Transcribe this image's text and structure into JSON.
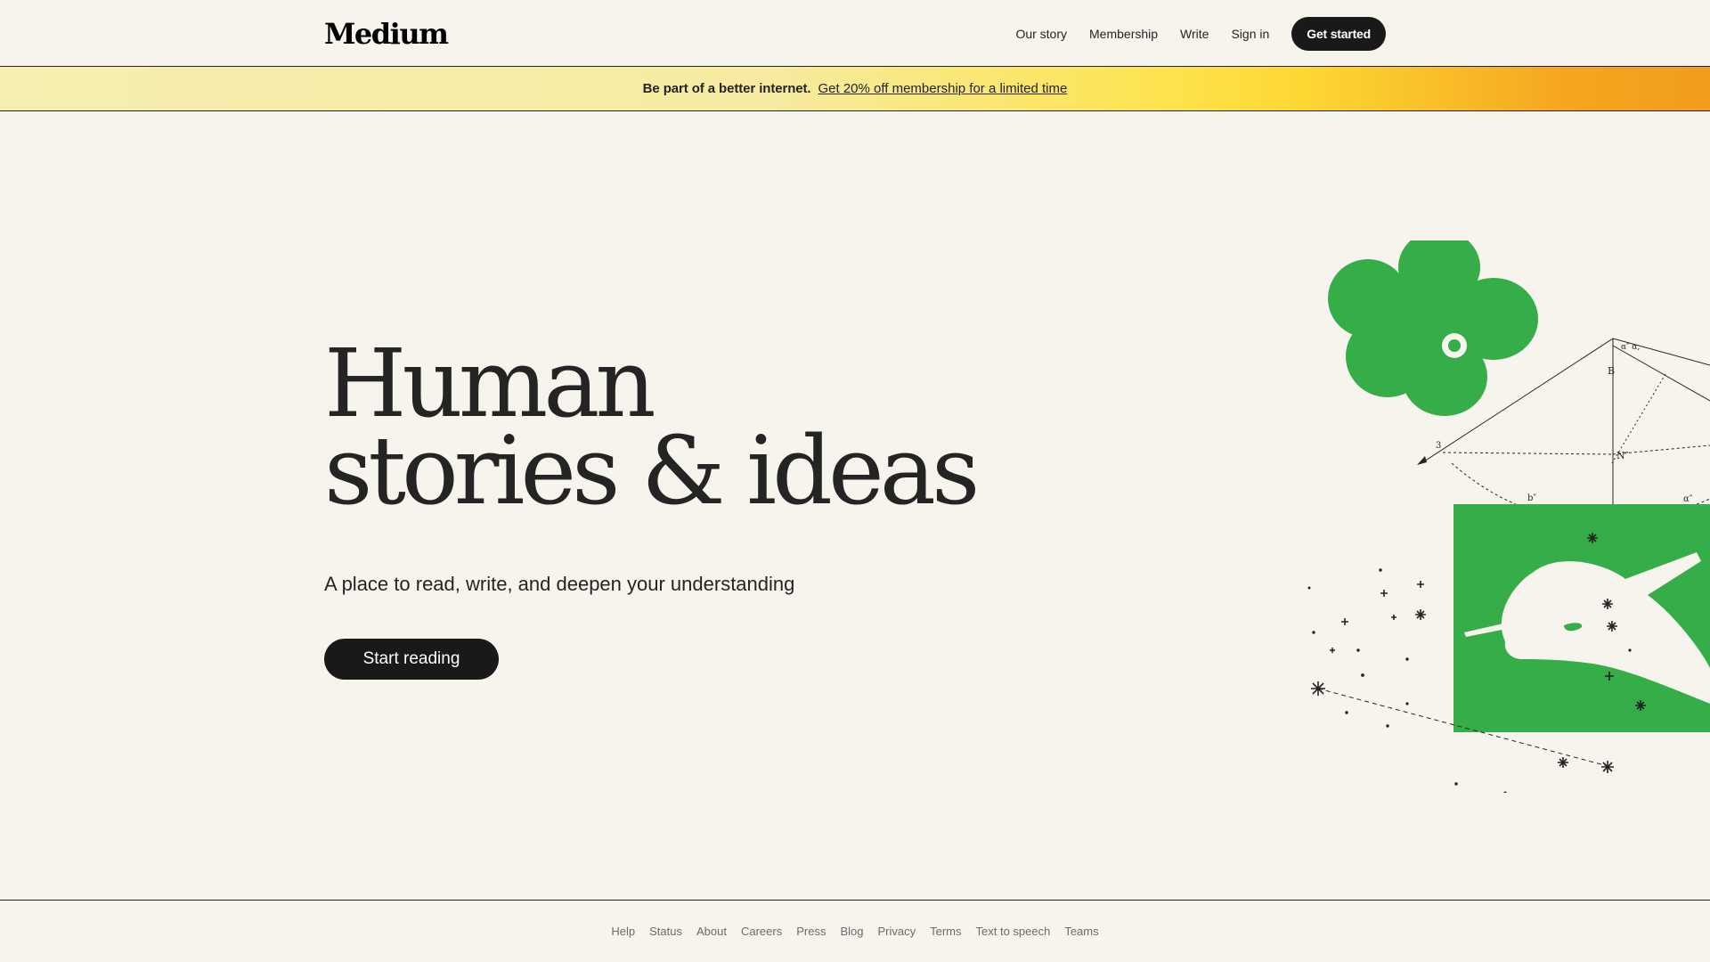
{
  "brand": {
    "logo": "Medium"
  },
  "nav": {
    "our_story": "Our story",
    "membership": "Membership",
    "write": "Write",
    "sign_in": "Sign in",
    "get_started": "Get started"
  },
  "banner": {
    "lead": "Be part of a better internet.",
    "offer": "Get 20% off membership for a limited time"
  },
  "hero": {
    "title_line1": "Human",
    "title_line2": "stories & ideas",
    "subtitle": "A place to read, write, and deepen your understanding",
    "cta": "Start reading"
  },
  "footer": {
    "links": [
      "Help",
      "Status",
      "About",
      "Careers",
      "Press",
      "Blog",
      "Privacy",
      "Terms",
      "Text to speech",
      "Teams"
    ]
  },
  "colors": {
    "background": "#f7f4ed",
    "text": "#242424",
    "button": "#191919",
    "illustration_green": "#35ad48",
    "banner_yellow": "#fde34f",
    "banner_orange": "#f19c1d"
  },
  "icons": [
    "flower-illustration",
    "geometry-diagram",
    "hand-writing-illustration",
    "star-constellation"
  ]
}
